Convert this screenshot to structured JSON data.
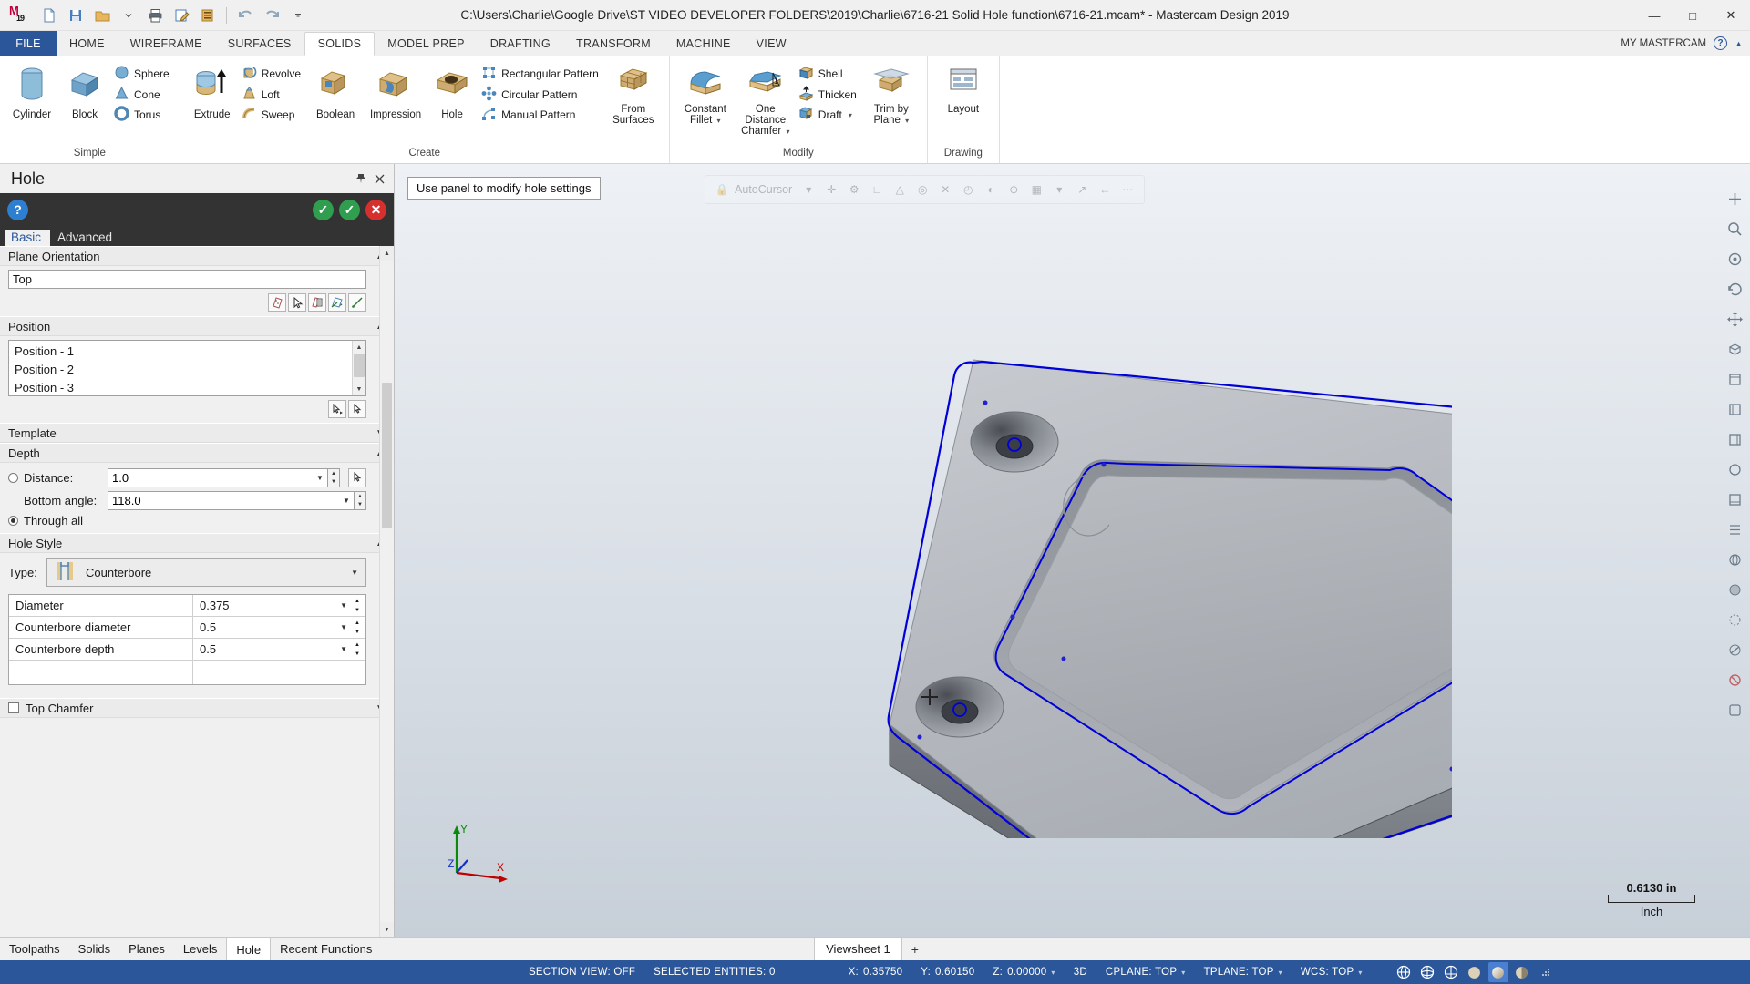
{
  "window": {
    "title": "C:\\Users\\Charlie\\Google Drive\\ST VIDEO DEVELOPER FOLDERS\\2019\\Charlie\\6716-21 Solid Hole function\\6716-21.mcam* - Mastercam Design 2019",
    "logo": "19",
    "minimize": "—",
    "maximize": "□",
    "close": "✕"
  },
  "quick_access": [
    {
      "name": "new-file-icon",
      "glyph": "new"
    },
    {
      "name": "save-icon",
      "glyph": "save"
    },
    {
      "name": "open-folder-icon",
      "glyph": "open"
    },
    {
      "name": "open-dropdown-icon",
      "glyph": "caret"
    },
    {
      "name": "print-icon",
      "glyph": "print"
    },
    {
      "name": "print-preview-icon",
      "glyph": "preview"
    },
    {
      "name": "file-list-icon",
      "glyph": "list"
    },
    {
      "name": "undo-icon",
      "glyph": "undo"
    },
    {
      "name": "redo-icon",
      "glyph": "redo"
    },
    {
      "name": "customize-qat-icon",
      "glyph": "caret"
    }
  ],
  "ribbon": {
    "tabs": [
      "FILE",
      "HOME",
      "WIREFRAME",
      "SURFACES",
      "SOLIDS",
      "MODEL PREP",
      "DRAFTING",
      "TRANSFORM",
      "MACHINE",
      "VIEW"
    ],
    "active_tab": "SOLIDS",
    "my_mastercam": "MY MASTERCAM",
    "help_badge": "?",
    "collapse_badge": "▲",
    "groups": [
      {
        "name": "Simple",
        "big": [
          {
            "label": "Cylinder",
            "icon": "cylinder-icon"
          },
          {
            "label": "Block",
            "icon": "block-icon"
          }
        ],
        "small": [
          {
            "label": "Sphere",
            "icon": "sphere-icon"
          },
          {
            "label": "Cone",
            "icon": "cone-icon"
          },
          {
            "label": "Torus",
            "icon": "torus-icon"
          }
        ]
      },
      {
        "name": "Create",
        "big": [
          {
            "label": "Extrude",
            "icon": "extrude-icon"
          },
          {
            "label": "Boolean",
            "icon": "boolean-icon"
          },
          {
            "label": "Impression",
            "icon": "impression-icon"
          },
          {
            "label": "Hole",
            "icon": "hole-icon"
          },
          {
            "label": "From Surfaces",
            "icon": "from-surfaces-icon"
          }
        ],
        "small": [
          {
            "label": "Revolve",
            "icon": "revolve-icon"
          },
          {
            "label": "Loft",
            "icon": "loft-icon"
          },
          {
            "label": "Sweep",
            "icon": "sweep-icon"
          },
          {
            "label": "Rectangular Pattern",
            "icon": "rectangular-pattern-icon"
          },
          {
            "label": "Circular Pattern",
            "icon": "circular-pattern-icon"
          },
          {
            "label": "Manual Pattern",
            "icon": "manual-pattern-icon"
          }
        ]
      },
      {
        "name": "Modify",
        "big": [
          {
            "label": "Constant Fillet",
            "icon": "constant-fillet-icon",
            "caret": true
          },
          {
            "label": "One Distance Chamfer",
            "icon": "one-distance-chamfer-icon",
            "caret": true
          },
          {
            "label": "Trim by Plane",
            "icon": "trim-by-plane-icon",
            "caret": true
          }
        ],
        "small": [
          {
            "label": "Shell",
            "icon": "shell-icon"
          },
          {
            "label": "Thicken",
            "icon": "thicken-icon"
          },
          {
            "label": "Draft",
            "icon": "draft-icon",
            "caret": true
          }
        ]
      },
      {
        "name": "Drawing",
        "big": [
          {
            "label": "Layout",
            "icon": "layout-icon"
          }
        ],
        "small": []
      }
    ]
  },
  "panel": {
    "title": "Hole",
    "pin_icon": "pin-icon",
    "close_icon": "close-icon",
    "toolbar": {
      "help": "?",
      "apply_ok": "✓",
      "ok": "✓",
      "cancel": "✕"
    },
    "tabs": [
      {
        "label": "Basic",
        "active": true
      },
      {
        "label": "Advanced",
        "active": false
      }
    ],
    "plane_orientation": {
      "section": "Plane Orientation",
      "value": "Top",
      "buttons": [
        "plane-selection-icon",
        "cursor-select-icon",
        "plane-list-icon",
        "plane-from-geometry-icon",
        "plane-axis-icon"
      ]
    },
    "position": {
      "section": "Position",
      "items": [
        "Position - 1",
        "Position - 2",
        "Position - 3"
      ],
      "buttons": [
        "reselect-icon",
        "add-position-icon"
      ]
    },
    "template": {
      "section": "Template"
    },
    "depth": {
      "section": "Depth",
      "distance_label": "Distance:",
      "distance_value": "1.0",
      "distance_selected": false,
      "bottom_angle_label": "Bottom angle:",
      "bottom_angle_value": "118.0",
      "through_all_label": "Through all",
      "through_all_selected": true,
      "pick_icon": "pick-point-icon"
    },
    "hole_style": {
      "section": "Hole Style",
      "type_label": "Type:",
      "type_value": "Counterbore",
      "type_icon": "counterbore-icon",
      "params": [
        {
          "name": "Diameter",
          "value": "0.375"
        },
        {
          "name": "Counterbore diameter",
          "value": "0.5"
        },
        {
          "name": "Counterbore depth",
          "value": "0.5"
        }
      ]
    },
    "top_chamfer": {
      "label": "Top Chamfer",
      "checked": false
    }
  },
  "viewport": {
    "tooltip": "Use panel to modify hole settings",
    "autocursor_label": "AutoCursor",
    "scale": {
      "value": "0.6130 in",
      "unit": "Inch"
    },
    "gnomon": {
      "x": "X",
      "y": "Y",
      "z": "Z"
    },
    "right_tools": [
      "fit-screen-icon",
      "unzoom-icon",
      "zoom-target-icon",
      "dynamic-rotate-icon",
      "pan-icon",
      "isometric-view-icon",
      "top-view-icon",
      "front-view-icon",
      "right-view-icon",
      "back-view-icon",
      "bottom-view-icon",
      "left-view-icon",
      "wireframe-icon",
      "shaded-icon",
      "hidden-lines-icon",
      "section-view-icon",
      "no-shade-icon",
      "blank-icon"
    ]
  },
  "bottom_tabs": {
    "tabs": [
      {
        "label": "Toolpaths",
        "active": false
      },
      {
        "label": "Solids",
        "active": false
      },
      {
        "label": "Planes",
        "active": false
      },
      {
        "label": "Levels",
        "active": false
      },
      {
        "label": "Hole",
        "active": true
      },
      {
        "label": "Recent Functions",
        "active": false
      }
    ],
    "viewsheet": "Viewsheet 1",
    "add": "+"
  },
  "status_bar": {
    "section_view": "SECTION VIEW: OFF",
    "selected_entities": "SELECTED ENTITIES: 0",
    "x_label": "X:",
    "x_value": "0.35750",
    "y_label": "Y:",
    "y_value": "0.60150",
    "z_label": "Z:",
    "z_value": "0.00000",
    "mode": "3D",
    "cplane": "CPLANE: TOP",
    "tplane": "TPLANE: TOP",
    "wcs": "WCS: TOP",
    "icons": [
      "gnomon-sphere-icon",
      "gnomon-sphere2-icon",
      "gnomon-sphere3-icon",
      "shade-off-icon",
      "shade-on-icon",
      "shade-half-icon",
      "resize-grip-icon"
    ]
  },
  "colors": {
    "accent": "#2b579a",
    "ok_green": "#2f9e4f",
    "cancel_red": "#d6302e",
    "help_blue": "#2f7fd1",
    "solid_edge_blue": "#0000d0"
  }
}
